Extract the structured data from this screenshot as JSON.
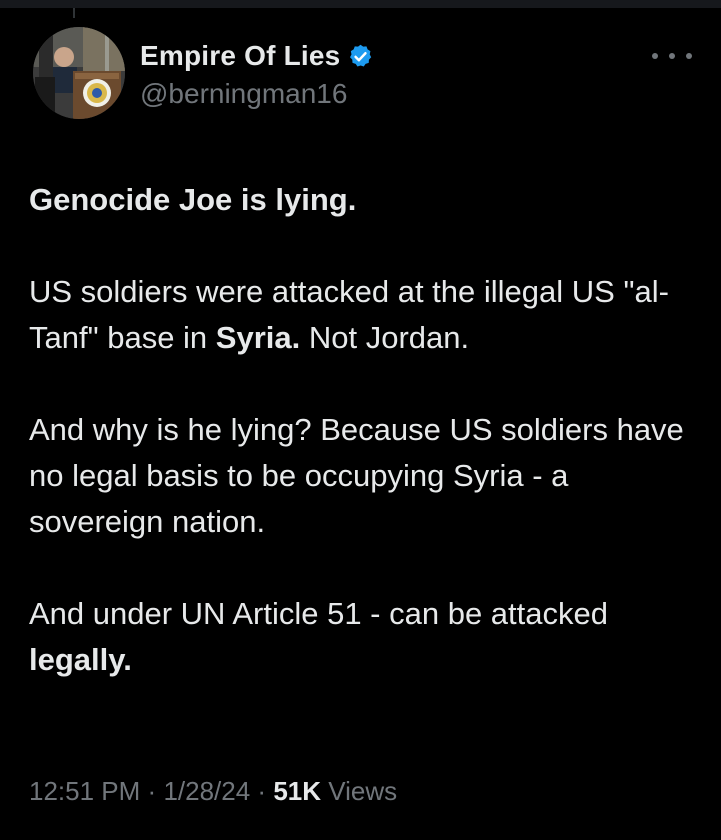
{
  "author": {
    "display_name": "Empire Of Lies",
    "handle": "@berningman16",
    "verified_color": "#1d9bf0"
  },
  "tweet": {
    "p1": "Genocide Joe is lying.",
    "p2a": "US soldiers were attacked at the illegal US \"al-Tanf\" base in ",
    "p2b": "Syria.",
    "p2c": " Not Jordan.",
    "p3": "And why is he lying? Because US soldiers have no legal basis to be occupying Syria - a sovereign nation.",
    "p4a": "And under UN Article 51 - can be attacked ",
    "p4b": "legally."
  },
  "meta": {
    "time": "12:51 PM",
    "sep1": "·",
    "date": "1/28/24",
    "sep2": "·",
    "views_count": "51K",
    "views_label": "Views"
  },
  "icons": {
    "verified": "verified-badge-icon",
    "more": "more-options-icon"
  }
}
